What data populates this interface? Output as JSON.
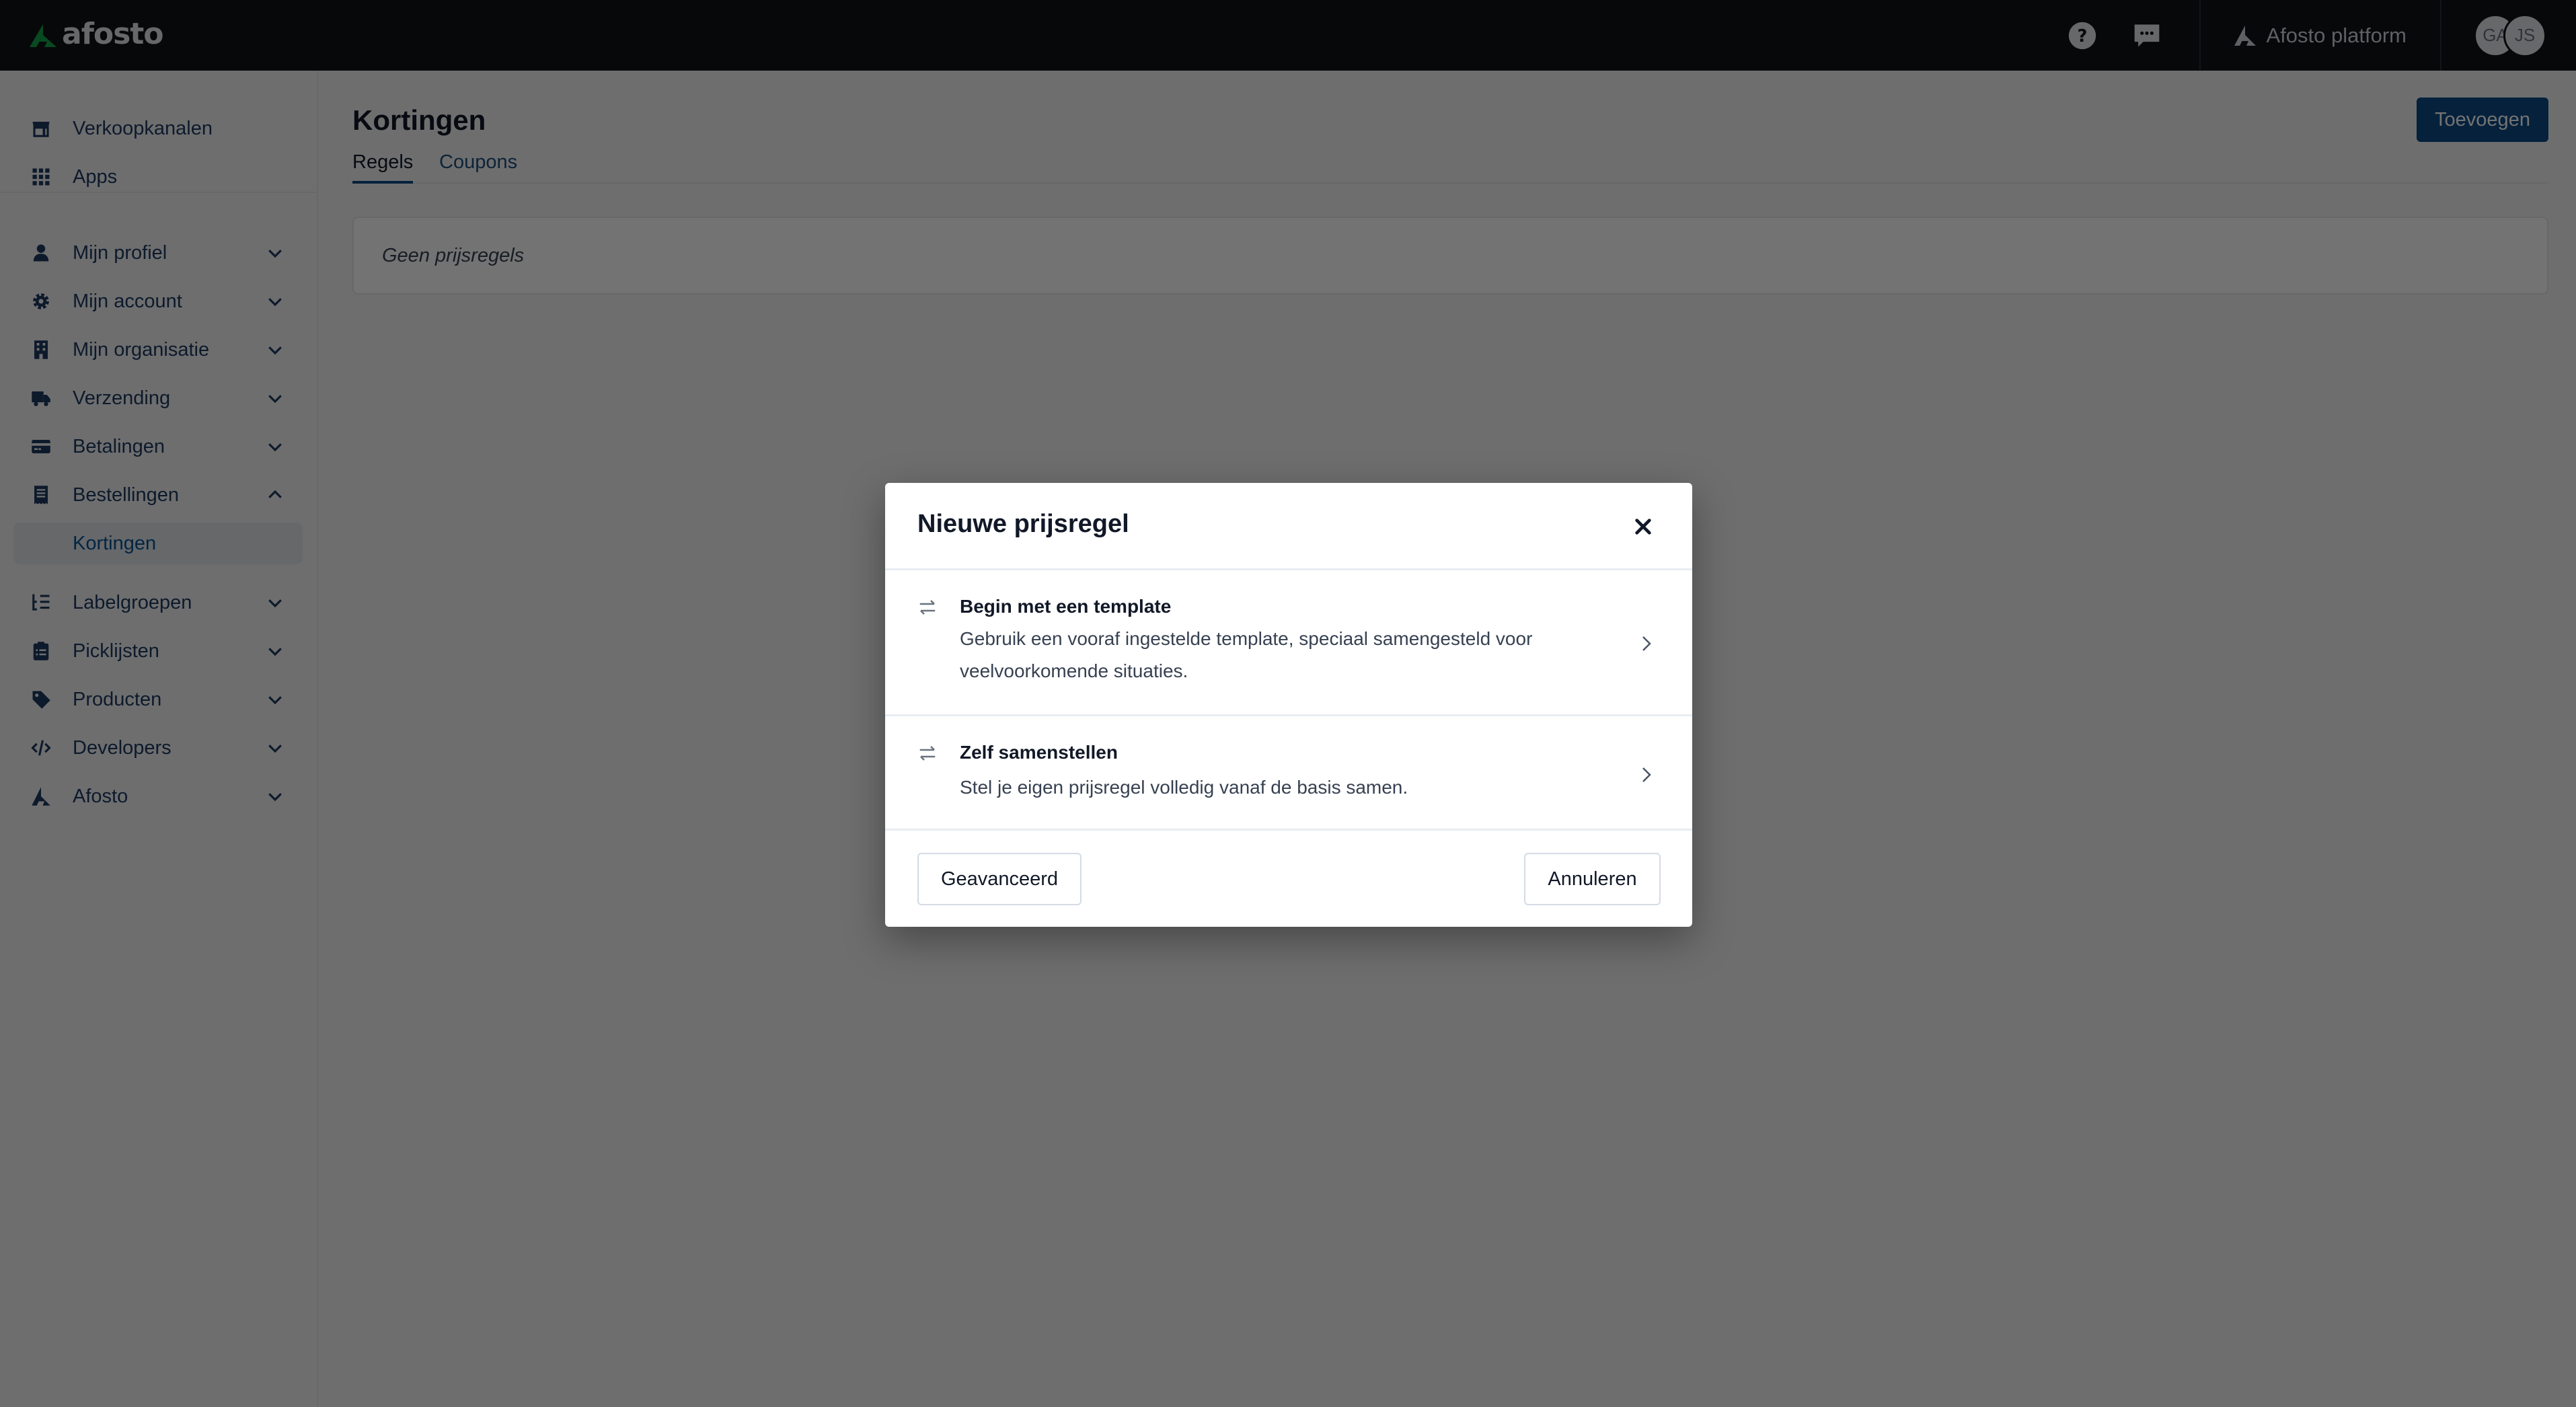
{
  "topbar": {
    "logo_text": "afosto",
    "help_icon": "question-circle-icon",
    "chat_icon": "chat-bubble-icon",
    "platform_label": "Afosto platform",
    "avatars": [
      "GA",
      "JS"
    ]
  },
  "sidebar": {
    "top_items": [
      {
        "label": "Verkoopkanalen",
        "icon": "store-icon"
      },
      {
        "label": "Apps",
        "icon": "grid-icon"
      }
    ],
    "items": [
      {
        "label": "Mijn profiel",
        "icon": "user-icon",
        "expanded": false
      },
      {
        "label": "Mijn account",
        "icon": "gear-icon",
        "expanded": false
      },
      {
        "label": "Mijn organisatie",
        "icon": "building-icon",
        "expanded": false
      },
      {
        "label": "Verzending",
        "icon": "truck-icon",
        "expanded": false
      },
      {
        "label": "Betalingen",
        "icon": "credit-card-icon",
        "expanded": false
      },
      {
        "label": "Bestellingen",
        "icon": "receipt-icon",
        "expanded": true
      },
      {
        "label": "Kortingen",
        "icon": null,
        "sub": true,
        "active": true
      },
      {
        "label": "Labelgroepen",
        "icon": "list-tree-icon",
        "expanded": false
      },
      {
        "label": "Picklijsten",
        "icon": "clipboard-list-icon",
        "expanded": false
      },
      {
        "label": "Producten",
        "icon": "tag-icon",
        "expanded": false
      },
      {
        "label": "Developers",
        "icon": "code-icon",
        "expanded": false
      },
      {
        "label": "Afosto",
        "icon": "afosto-logo-icon",
        "expanded": false
      }
    ]
  },
  "main": {
    "title": "Kortingen",
    "add_button": "Toevoegen",
    "tabs": [
      {
        "label": "Regels",
        "active": true
      },
      {
        "label": "Coupons",
        "active": false
      }
    ],
    "empty_text": "Geen prijsregels"
  },
  "modal": {
    "title": "Nieuwe prijsregel",
    "options": [
      {
        "title": "Begin met een template",
        "description": "Gebruik een vooraf ingestelde template, speciaal samengesteld voor veelvoorkomende situaties.",
        "icon": "arrows-exchange-icon"
      },
      {
        "title": "Zelf samenstellen",
        "description": "Stel je eigen prijsregel volledig vanaf de basis samen.",
        "icon": "arrows-exchange-icon"
      }
    ],
    "advanced_button": "Geavanceerd",
    "cancel_button": "Annuleren"
  },
  "colors": {
    "topbar_bg": "#111318",
    "brand_green": "#16a34a",
    "primary_blue": "#0d4a86",
    "active_link": "#0b5394",
    "overlay": "rgba(0,0,0,0.55)"
  }
}
